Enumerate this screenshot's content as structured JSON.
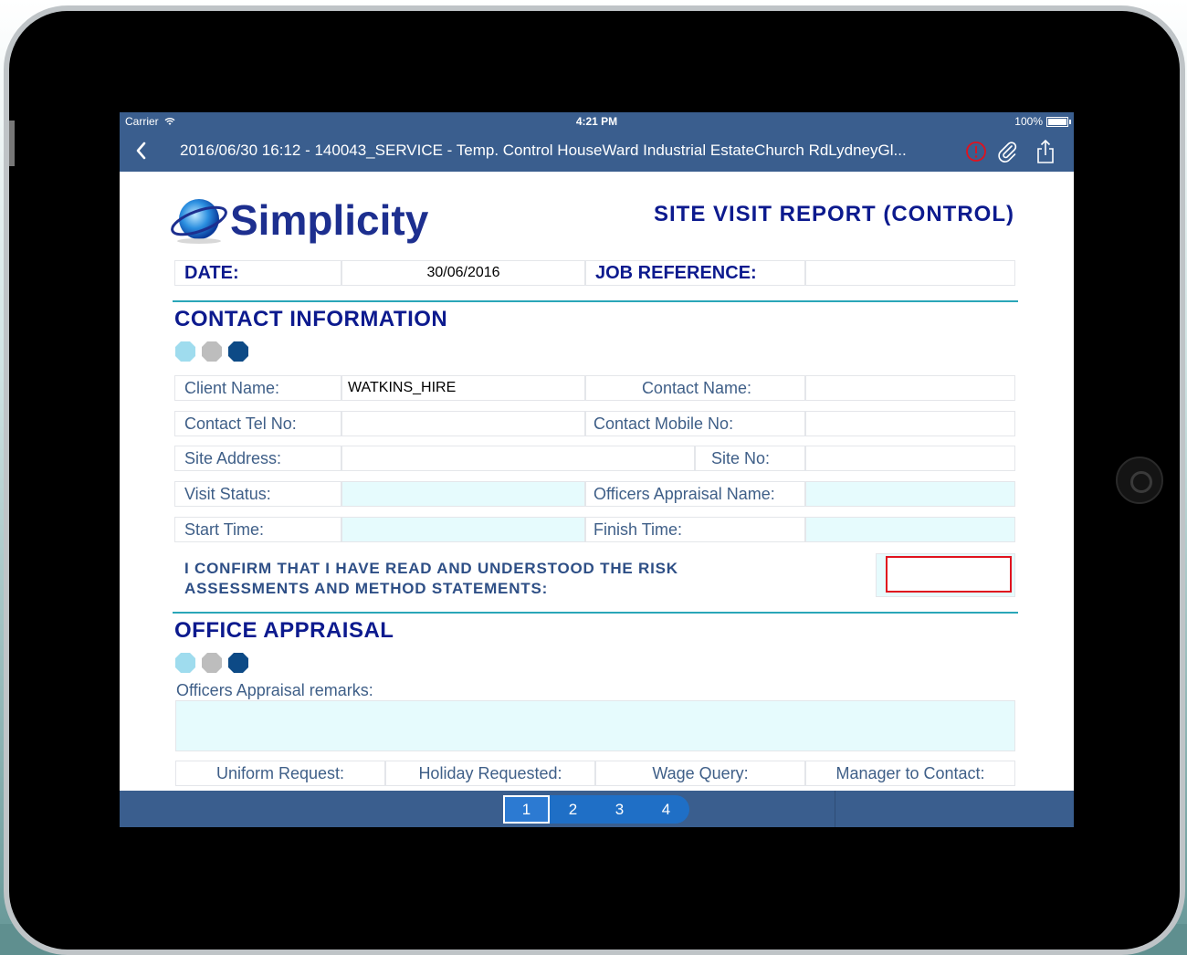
{
  "status_bar": {
    "carrier": "Carrier",
    "time": "4:21 PM",
    "battery": "100%"
  },
  "nav": {
    "title": "2016/06/30 16:12 - 140043_SERVICE - Temp. Control HouseWard Industrial EstateChurch RdLydneyGl...",
    "icons": [
      "back-chevron-icon",
      "alert-icon",
      "paperclip-icon",
      "share-icon"
    ]
  },
  "colors": {
    "nav_bar": "#3a5e8e",
    "heading": "#0c1a8e",
    "label": "#3f5f88",
    "field_fill": "#e6fbfd",
    "divider": "#2aa6b8",
    "required_border": "#e0121e",
    "pager": "#1f6fc6"
  },
  "header": {
    "logo_text": "Simplicity",
    "report_title": "SITE VISIT REPORT (CONTROL)",
    "date_label": "DATE:",
    "date_value": "30/06/2016",
    "job_ref_label": "JOB REFERENCE:",
    "job_ref_value": ""
  },
  "contact": {
    "heading": "CONTACT INFORMATION",
    "client_name_label": "Client Name:",
    "client_name_value": "WATKINS_HIRE",
    "contact_name_label": "Contact Name:",
    "contact_name_value": "",
    "contact_tel_label": "Contact Tel No:",
    "contact_tel_value": "",
    "contact_mobile_label": "Contact Mobile No:",
    "contact_mobile_value": "",
    "site_address_label": "Site Address:",
    "site_address_value": "",
    "site_no_label": "Site No:",
    "site_no_value": "",
    "visit_status_label": "Visit Status:",
    "visit_status_value": "",
    "officers_appraisal_name_label": "Officers Appraisal Name:",
    "officers_appraisal_name_value": "",
    "start_time_label": "Start Time:",
    "start_time_value": "",
    "finish_time_label": "Finish Time:",
    "finish_time_value": "",
    "confirm_line1": "I CONFIRM THAT I HAVE READ AND UNDERSTOOD THE RISK",
    "confirm_line2": "ASSESSMENTS AND METHOD STATEMENTS:"
  },
  "office": {
    "heading": "OFFICE APPRAISAL",
    "remarks_label": "Officers Appraisal remarks:",
    "remarks_value": "",
    "uniform_request": "Uniform Request:",
    "holiday_requested": "Holiday Requested:",
    "wage_query": "Wage Query:",
    "manager_to_contact": "Manager to Contact:"
  },
  "pager": {
    "pages": [
      "1",
      "2",
      "3",
      "4"
    ],
    "current": "1"
  }
}
